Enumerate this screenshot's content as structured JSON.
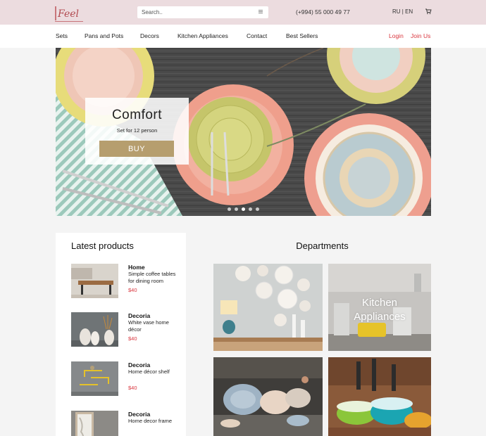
{
  "header": {
    "logo_text": "Feel",
    "search_placeholder": "Search..",
    "phone": "(+994) 55 000 49 77",
    "lang_ru": "RU",
    "lang_sep": " | ",
    "lang_en": "EN"
  },
  "nav": {
    "items": [
      "Sets",
      "Pans and Pots",
      "Decors",
      "Kitchen Appliances",
      "Contact",
      "Best Sellers"
    ],
    "login": "Login",
    "join": "Join Us"
  },
  "hero": {
    "title": "Comfort",
    "subtitle": "Set for 12 person",
    "button": "BUY",
    "slides_total": 5,
    "active_slide": 3
  },
  "latest": {
    "title": "Latest products",
    "products": [
      {
        "name": "Home",
        "desc": "Simple coffee tables for dining room",
        "price": "$40"
      },
      {
        "name": "Decoria",
        "desc": "White vase home décor",
        "price": "$40"
      },
      {
        "name": "Decoria",
        "desc": "Home décor shelf",
        "price": "$40"
      },
      {
        "name": "Decoria",
        "desc": "Home decor frame",
        "price": ""
      }
    ]
  },
  "departments": {
    "title": "Departments",
    "tiles": [
      {
        "label": ""
      },
      {
        "label": "Kitchen Appliances"
      },
      {
        "label": ""
      },
      {
        "label": ""
      }
    ]
  },
  "colors": {
    "topbar_bg": "#ecdcdf",
    "accent_red": "#d9363e",
    "buy_button": "#b69e6e",
    "page_bg": "#f4f4f4"
  }
}
